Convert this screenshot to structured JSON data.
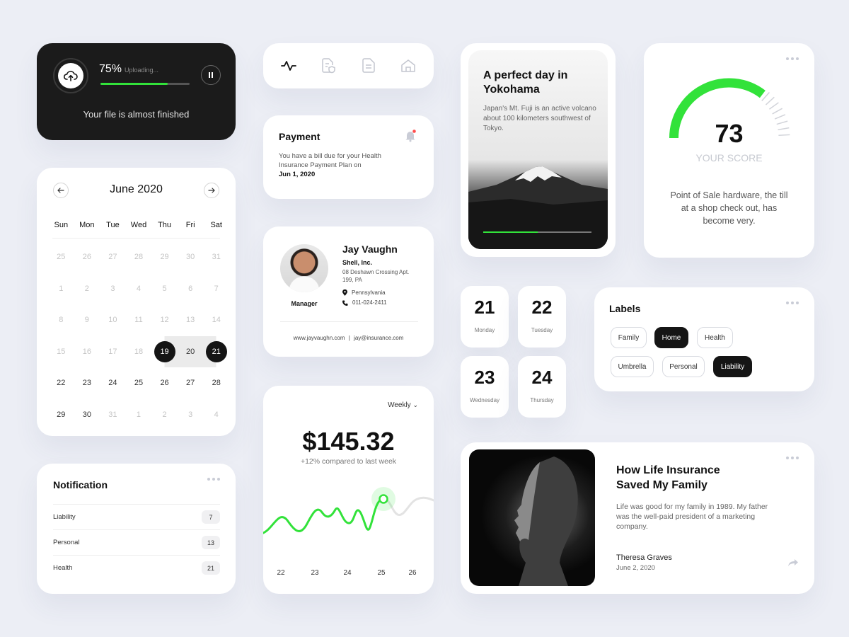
{
  "upload": {
    "percent_label": "75%",
    "progress": 0.75,
    "state": "Uploading...",
    "message": "Your file is almost finished"
  },
  "iconbar": {
    "icons": [
      "activity-icon",
      "document-shield-icon",
      "document-icon",
      "home-icon"
    ]
  },
  "payment": {
    "title": "Payment",
    "text": "You have a bill due for your Health Insurance Payment Plan on",
    "date": "Jun 1, 2020"
  },
  "profile": {
    "name": "Jay Vaughn",
    "company": "Shell, Inc.",
    "address": "08 Deshawn Crossing Apt. 199, PA",
    "location": "Pennsylvania",
    "phone": "011-024-2411",
    "role": "Manager",
    "website": "www.jayvaughn.com",
    "email": "jay@insurance.com",
    "link_separator": "|"
  },
  "fuji": {
    "title": "A perfect day in Yokohama",
    "text": "Japan's Mt. Fuji is an active volcano about 100 kilometers southwest of Tokyo.",
    "progress": 0.5
  },
  "score": {
    "value": "73",
    "label": "YOUR SCORE",
    "fraction": 0.73,
    "description": "Point of Sale hardware, the till at a shop check out, has become very."
  },
  "calendar": {
    "month": "June 2020",
    "weekdays": [
      "Sun",
      "Mon",
      "Tue",
      "Wed",
      "Thu",
      "Fri",
      "Sat"
    ],
    "days": [
      {
        "d": "25",
        "m": true
      },
      {
        "d": "26",
        "m": true
      },
      {
        "d": "27",
        "m": true
      },
      {
        "d": "28",
        "m": true
      },
      {
        "d": "29",
        "m": true
      },
      {
        "d": "30",
        "m": true
      },
      {
        "d": "31",
        "m": true
      },
      {
        "d": "1",
        "m": true
      },
      {
        "d": "2",
        "m": true
      },
      {
        "d": "3",
        "m": true
      },
      {
        "d": "4",
        "m": true
      },
      {
        "d": "5",
        "m": true
      },
      {
        "d": "6",
        "m": true
      },
      {
        "d": "7",
        "m": true
      },
      {
        "d": "8",
        "m": true
      },
      {
        "d": "9",
        "m": true
      },
      {
        "d": "10",
        "m": true
      },
      {
        "d": "11",
        "m": true
      },
      {
        "d": "12",
        "m": true
      },
      {
        "d": "13",
        "m": true
      },
      {
        "d": "14",
        "m": true
      },
      {
        "d": "15",
        "m": true
      },
      {
        "d": "16",
        "m": true
      },
      {
        "d": "17",
        "m": true
      },
      {
        "d": "18",
        "m": true
      },
      {
        "d": "19",
        "sel": "start"
      },
      {
        "d": "20",
        "sel": "mid"
      },
      {
        "d": "21",
        "sel": "end"
      },
      {
        "d": "22",
        "dot": true
      },
      {
        "d": "23"
      },
      {
        "d": "24"
      },
      {
        "d": "25"
      },
      {
        "d": "26"
      },
      {
        "d": "27"
      },
      {
        "d": "28"
      },
      {
        "d": "29"
      },
      {
        "d": "30"
      },
      {
        "d": "31",
        "m": true
      },
      {
        "d": "1",
        "m": true
      },
      {
        "d": "2",
        "m": true
      },
      {
        "d": "3",
        "m": true
      },
      {
        "d": "4",
        "m": true
      }
    ]
  },
  "notification": {
    "title": "Notification",
    "items": [
      {
        "label": "Liability",
        "count": "7"
      },
      {
        "label": "Personal",
        "count": "13"
      },
      {
        "label": "Health",
        "count": "21"
      }
    ]
  },
  "amount": {
    "period": "Weekly",
    "value": "$145.32",
    "comparison": "+12% compared to last week",
    "x_labels": [
      "22",
      "23",
      "24",
      "25",
      "26"
    ],
    "highlight_color": "#32e23a"
  },
  "days": [
    {
      "num": "21",
      "weekday": "Monday"
    },
    {
      "num": "22",
      "weekday": "Tuesday"
    },
    {
      "num": "23",
      "weekday": "Wednesday"
    },
    {
      "num": "24",
      "weekday": "Thursday"
    }
  ],
  "labels": {
    "title": "Labels",
    "chips": [
      {
        "text": "Family",
        "active": false
      },
      {
        "text": "Home",
        "active": true
      },
      {
        "text": "Health",
        "active": false
      },
      {
        "text": "Umbrella",
        "active": false
      },
      {
        "text": "Personal",
        "active": false
      },
      {
        "text": "Liability",
        "active": true
      }
    ]
  },
  "story": {
    "title": "How Life Insurance Saved My Family",
    "text": "Life was good for my family in 1989. My father was the well-paid president of a marketing company.",
    "author": "Theresa Graves",
    "date": "June 2, 2020"
  },
  "colors": {
    "accent": "#32e23a",
    "dark": "#151515",
    "background": "#eceef5"
  }
}
